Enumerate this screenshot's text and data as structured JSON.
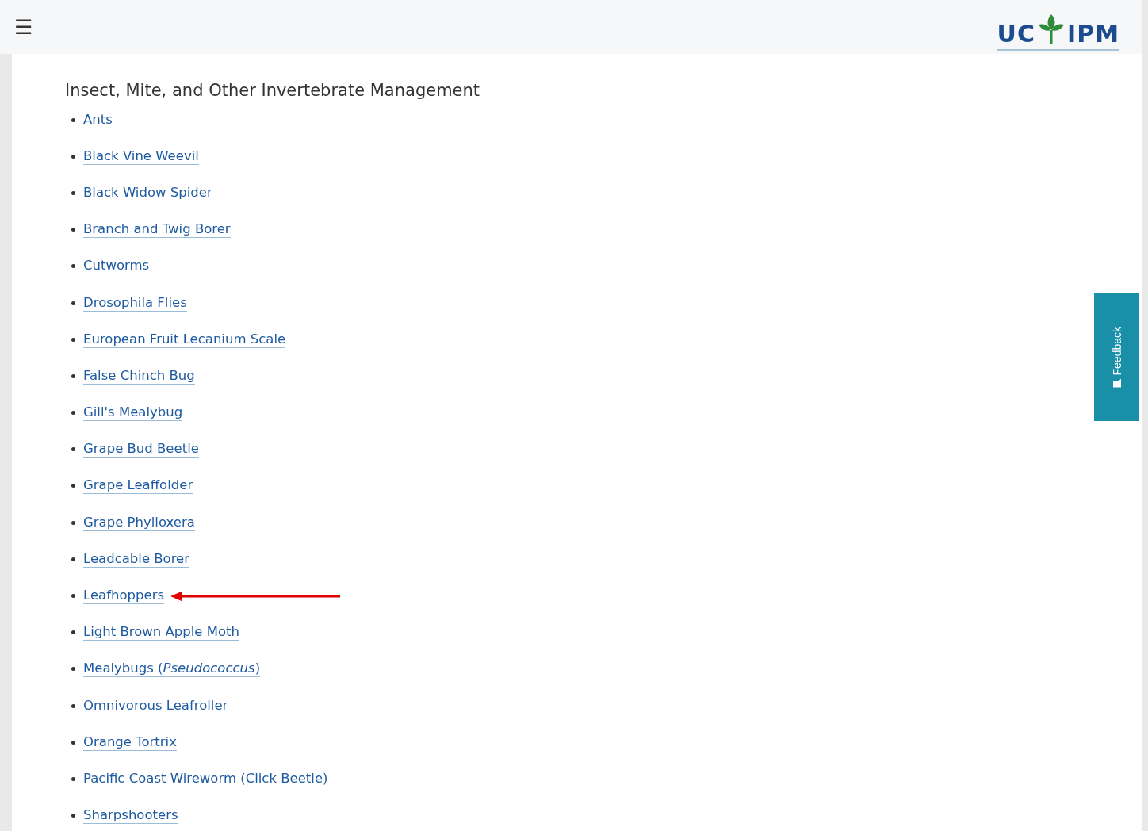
{
  "header": {
    "menu_icon": "☰",
    "logo": {
      "left": "UC",
      "right": "IPM"
    }
  },
  "section": {
    "title": "Insect, Mite, and Other Invertebrate Management",
    "links": [
      {
        "label": "Ants",
        "highlighted": false
      },
      {
        "label": "Black Vine Weevil",
        "highlighted": false
      },
      {
        "label": "Black Widow Spider",
        "highlighted": false
      },
      {
        "label": "Branch and Twig Borer",
        "highlighted": false
      },
      {
        "label": "Cutworms",
        "highlighted": false
      },
      {
        "label": "Drosophila Flies",
        "highlighted": false
      },
      {
        "label": "European Fruit Lecanium Scale",
        "highlighted": false
      },
      {
        "label": "False Chinch Bug",
        "highlighted": false
      },
      {
        "label": "Gill's Mealybug",
        "highlighted": false
      },
      {
        "label": "Grape Bud Beetle",
        "highlighted": false
      },
      {
        "label": "Grape Leaffolder",
        "highlighted": false
      },
      {
        "label": "Grape Phylloxera",
        "highlighted": false
      },
      {
        "label": "Leadcable Borer",
        "highlighted": false
      },
      {
        "label": "Leafhoppers",
        "highlighted": true
      },
      {
        "label": "Light Brown Apple Moth",
        "highlighted": false
      },
      {
        "label": "Mealybugs (*Pseudococcus*)",
        "highlighted": false
      },
      {
        "label": "Omnivorous Leafroller",
        "highlighted": false
      },
      {
        "label": "Orange Tortrix",
        "highlighted": false
      },
      {
        "label": "Pacific Coast Wireworm (Click Beetle)",
        "highlighted": false
      },
      {
        "label": "Sharpshooters",
        "highlighted": false
      }
    ]
  },
  "feedback_tab": {
    "label": "Feedback"
  }
}
